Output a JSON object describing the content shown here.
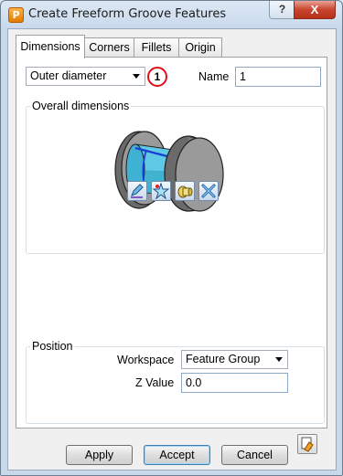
{
  "window": {
    "app_icon_letter": "P",
    "title": "Create Freeform Groove Features",
    "help_label": "?",
    "close_label": "X"
  },
  "tabs": [
    {
      "label": "Dimensions",
      "active": true
    },
    {
      "label": "Corners",
      "active": false
    },
    {
      "label": "Fillets",
      "active": false
    },
    {
      "label": "Origin",
      "active": false
    }
  ],
  "dimensions": {
    "type_select_value": "Outer diameter",
    "callout_number": "1",
    "name_label": "Name",
    "name_value": "1",
    "overall_group_title": "Overall dimensions",
    "tool_buttons": [
      "edit-pencil-icon",
      "star-select-icon",
      "groove-profile-icon",
      "cross-tools-icon"
    ]
  },
  "position": {
    "group_title": "Position",
    "workspace_label": "Workspace",
    "workspace_value": "Feature Group",
    "z_label": "Z Value",
    "z_value": "0.0"
  },
  "footer": {
    "apply_label": "Apply",
    "accept_label": "Accept",
    "cancel_label": "Cancel"
  },
  "colors": {
    "callout_circle": "#e0101a",
    "groove_body": "#5fc9e6",
    "highlight_edge": "#1a3fd6",
    "close_button": "#c8442e"
  }
}
